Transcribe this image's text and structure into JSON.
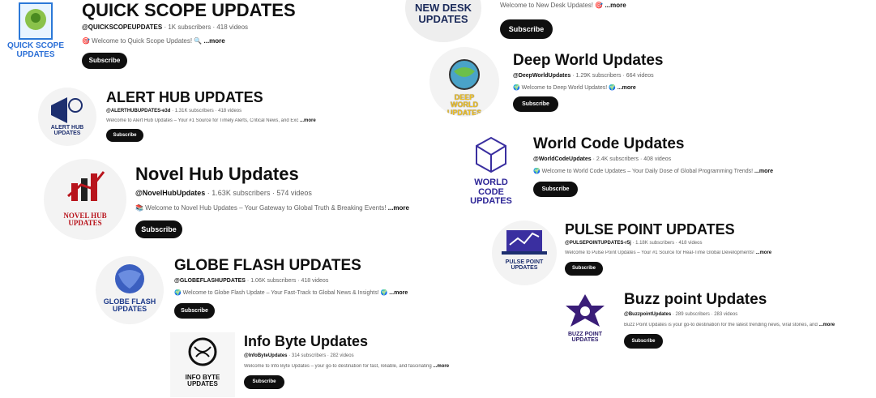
{
  "channels": [
    {
      "title": "QUICK SCOPE UPDATES",
      "handle": "@QUICKSCOPEUPDATES",
      "stats": "1K subscribers · 418 videos",
      "desc": "🎯 Welcome to Quick Scope Updates! 🔍",
      "more": "...more",
      "subscribe": "Subscribe",
      "avatar_label": "QUICK SCOPE UPDATES",
      "icon": "sparkle-icon"
    },
    {
      "title": "",
      "handle": "",
      "stats": "",
      "desc": "Welcome to New Desk Updates! 🎯",
      "more": "...more",
      "subscribe": "Subscribe",
      "avatar_label": "NEW DESK UPDATES",
      "icon": "desk-icon"
    },
    {
      "title": "ALERT HUB UPDATES",
      "handle": "@ALERTHUBUPDATES-e3d",
      "stats": "1.31K subscribers · 418 videos",
      "desc": "Welcome to Alert Hub Updates – Your #1 Source for Timely Alerts, Critical News, and Exc",
      "more": "...more",
      "subscribe": "Subscribe",
      "avatar_label": "ALERT HUB UPDATES",
      "icon": "megaphone-icon"
    },
    {
      "title": "Deep World Updates",
      "handle": "@DeepWorldUpdates",
      "stats": "1.29K subscribers · 664 videos",
      "desc": "🌍 Welcome to Deep World Updates! 🌍",
      "more": "...more",
      "subscribe": "Subscribe",
      "avatar_label": "DEEP WORLD UPDATES",
      "icon": "globe-icon"
    },
    {
      "title": "World Code Updates",
      "handle": "@WorldCodeUpdates",
      "stats": "2.4K subscribers · 408 videos",
      "desc": "🌍 Welcome to World Code Updates – Your Daily Dose of Global Programming Trends!",
      "more": "...more",
      "subscribe": "Subscribe",
      "avatar_label": "WORLD CODE UPDATES",
      "icon": "cube-icon"
    },
    {
      "title": "Novel Hub Updates",
      "handle": "@NovelHubUpdates",
      "stats": "1.63K subscribers · 574 videos",
      "desc": "📚 Welcome to Novel Hub Updates – Your Gateway to Global Truth & Breaking Events!",
      "more": "...more",
      "subscribe": "Subscribe",
      "avatar_label": "NOVEL HUB UPDATES",
      "icon": "chart-up-icon"
    },
    {
      "title": "PULSE POINT UPDATES",
      "handle": "@PULSEPOINTUPDATES-r5j",
      "stats": "1.18K subscribers · 418 videos",
      "desc": "Welcome to Pulse Point Updates – Your #1 Source for Real-Time Global Developments!",
      "more": "...more",
      "subscribe": "Subscribe",
      "avatar_label": "PULSE POINT UPDATES",
      "icon": "laptop-icon"
    },
    {
      "title": "GLOBE FLASH UPDATES",
      "handle": "@GLOBEFLASHUPDATES",
      "stats": "1.06K subscribers · 418 videos",
      "desc": "🌍 Welcome to Globe Flash Update – Your Fast-Track to Global News & Insights! 🌍",
      "more": "...more",
      "subscribe": "Subscribe",
      "avatar_label": "GLOBE FLASH UPDATES",
      "icon": "globe-icon"
    },
    {
      "title": "Buzz point Updates",
      "handle": "@BuzzpointUpdates",
      "stats": "289 subscribers · 283 videos",
      "desc": "Buzz Point Updates is your go-to destination for the latest trending news, viral stories, and",
      "more": "...more",
      "subscribe": "Subscribe",
      "avatar_label": "BUZZ POINT UPDATES",
      "icon": "star-icon"
    },
    {
      "title": "Info Byte Updates",
      "handle": "@InfoByteUpdates",
      "stats": "314 subscribers · 282 videos",
      "desc": "Welcome to Info Byte Updates – your go-to destination for fast, reliable, and fascinating",
      "more": "...more",
      "subscribe": "Subscribe",
      "avatar_label": "INFO BYTE UPDATES",
      "icon": "brain-icon"
    }
  ],
  "colors": {
    "button": "#0f0f0f",
    "meta": "#606060",
    "navy": "#1d2f6f",
    "red": "#b8141c"
  }
}
